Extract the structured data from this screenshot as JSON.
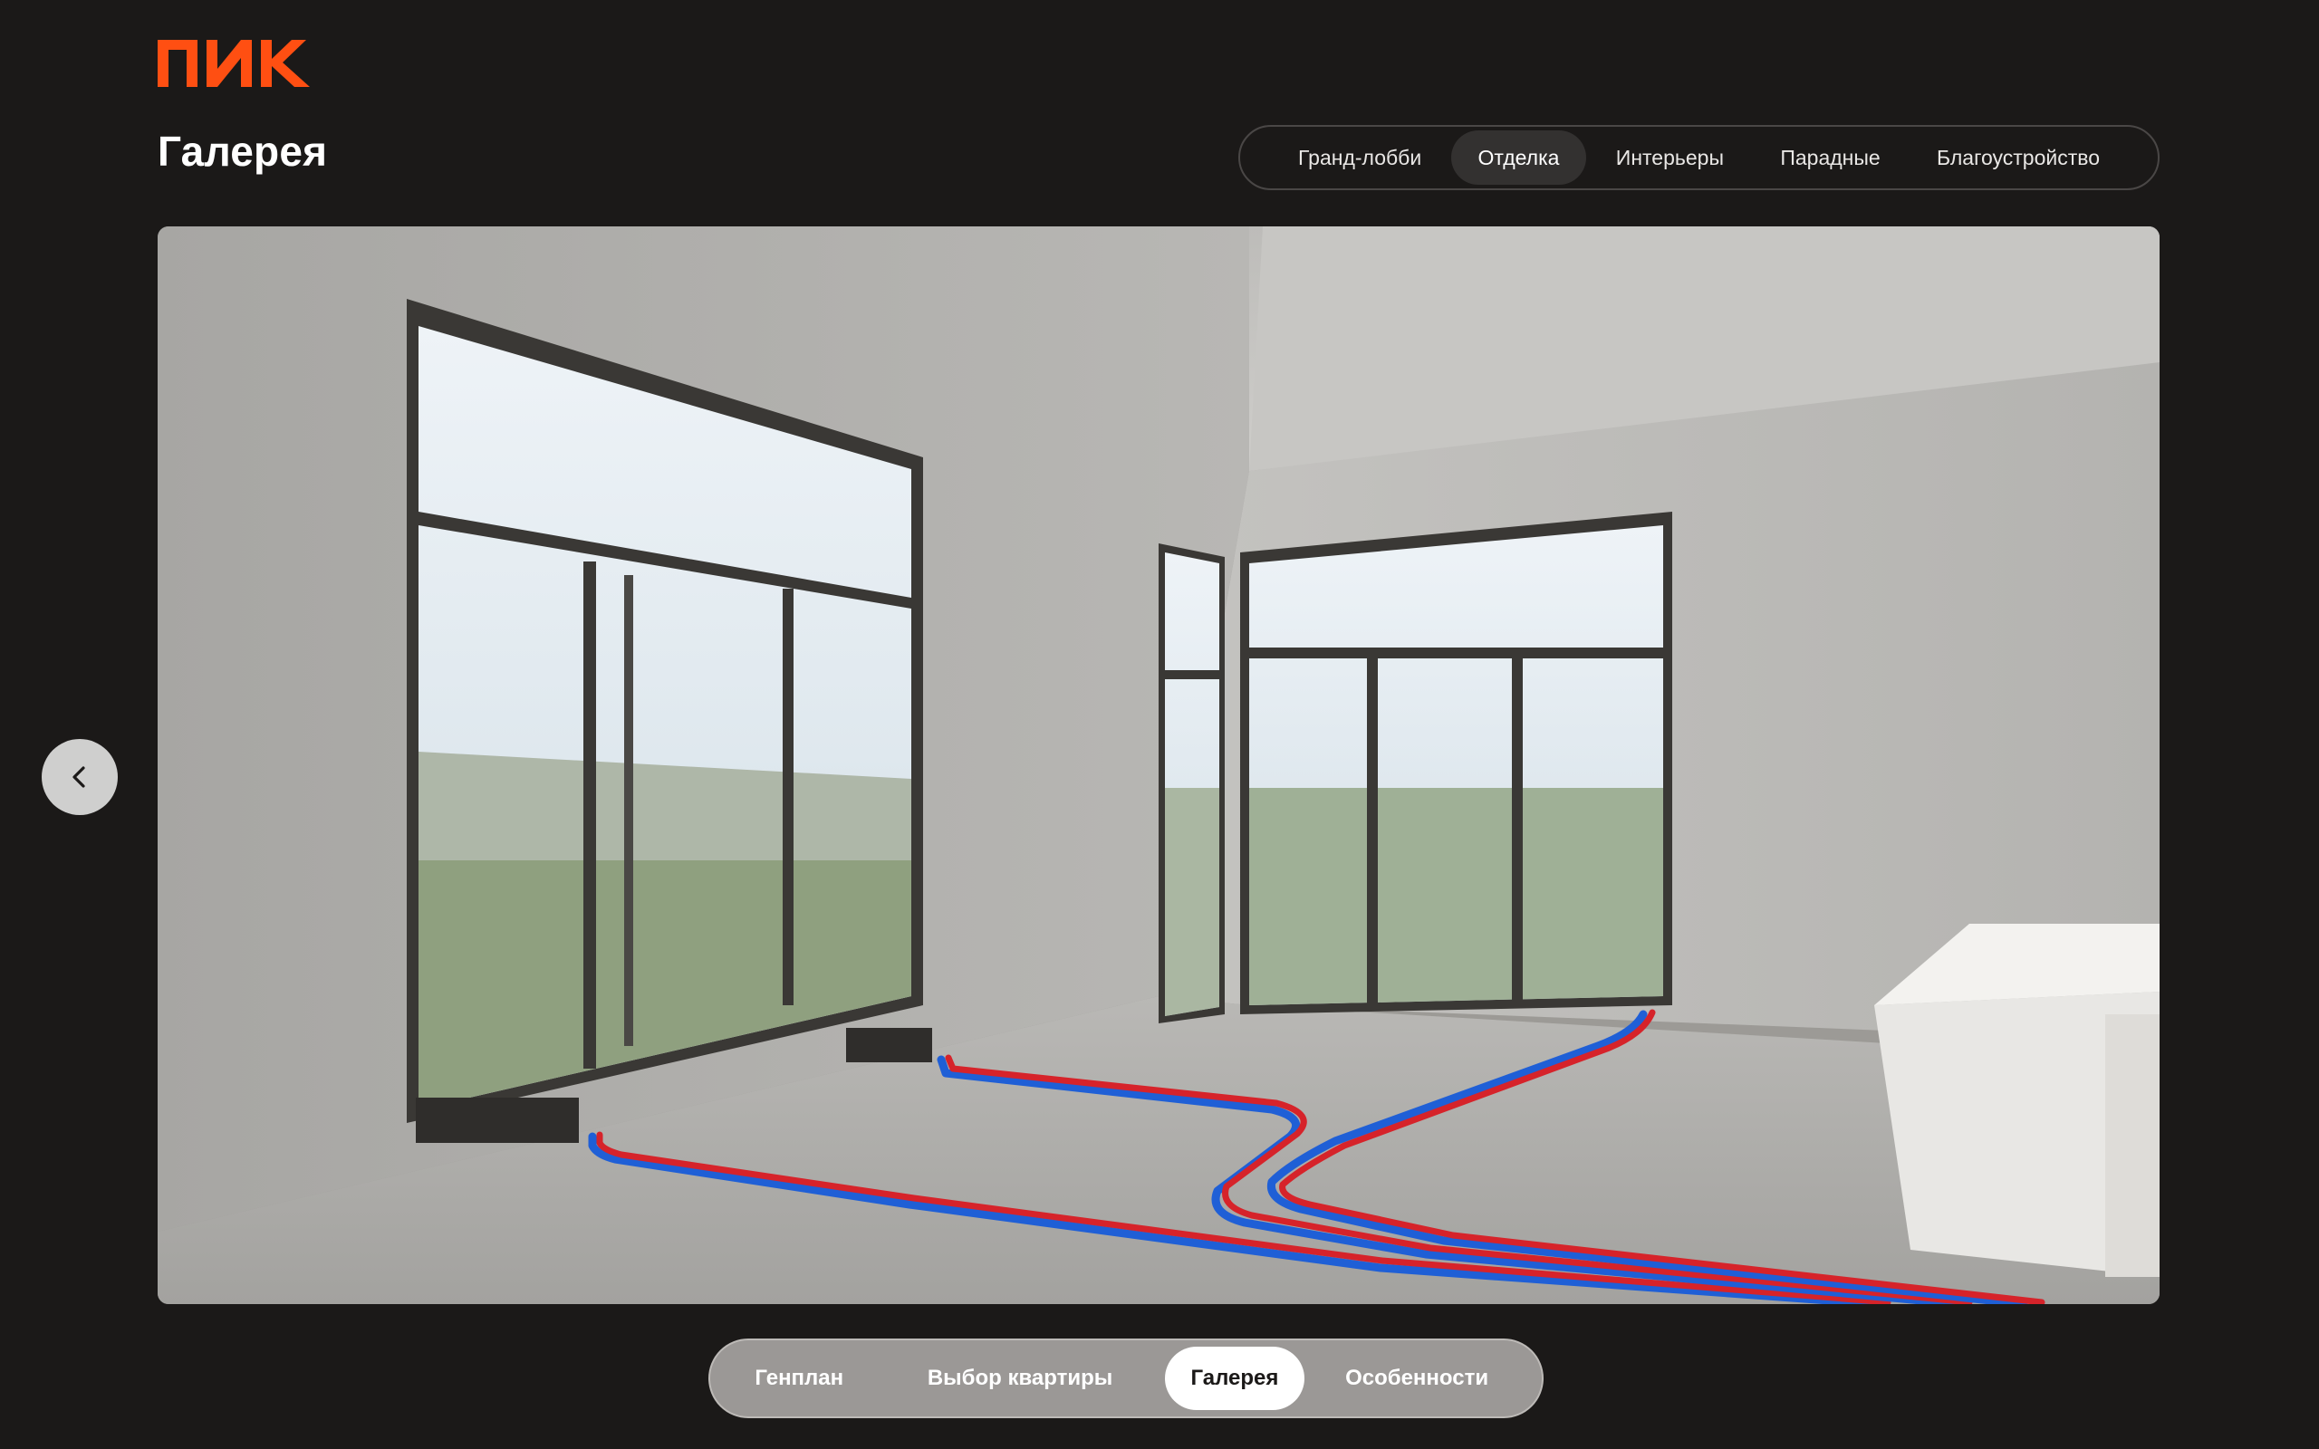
{
  "brand": {
    "logo_text": "ПИК",
    "accent_color": "#ff4f12"
  },
  "page_title": "Галерея",
  "top_tabs": [
    {
      "label": "Гранд-лобби",
      "active": false
    },
    {
      "label": "Отделка",
      "active": true
    },
    {
      "label": "Интерьеры",
      "active": false
    },
    {
      "label": "Парадные",
      "active": false
    },
    {
      "label": "Благоустройство",
      "active": false
    }
  ],
  "gallery": {
    "image_subject": "interior-unfinished-apartment-with-floor-heating-pipes",
    "prev_icon": "chevron-left-icon"
  },
  "bottom_nav": [
    {
      "label": "Генплан",
      "active": false
    },
    {
      "label": "Выбор квартиры",
      "active": false
    },
    {
      "label": "Галерея",
      "active": true
    },
    {
      "label": "Особенности",
      "active": false
    }
  ]
}
